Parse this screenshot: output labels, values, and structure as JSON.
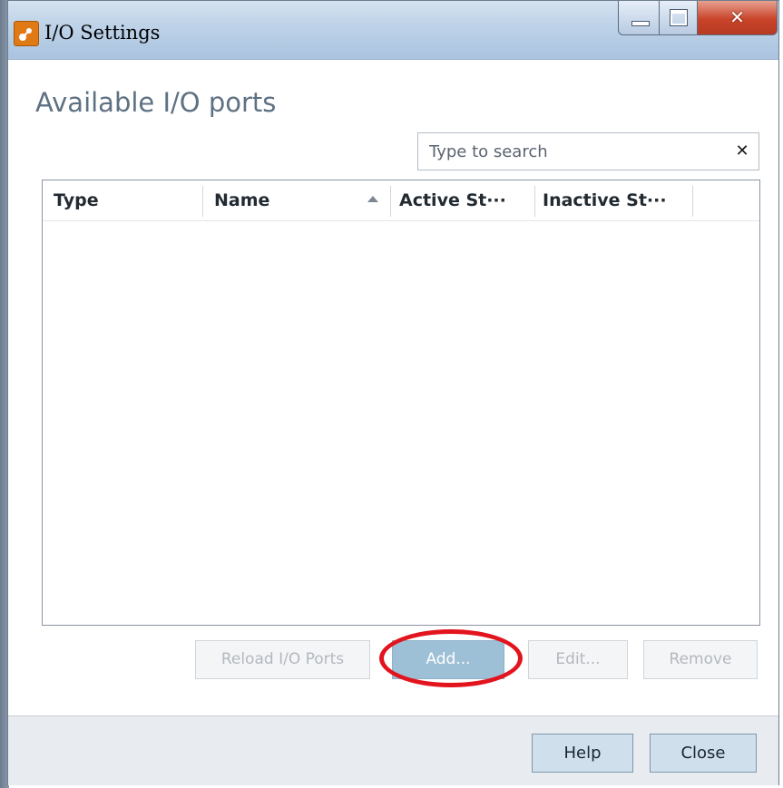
{
  "window": {
    "title": "I/O Settings"
  },
  "heading": "Available I/O ports",
  "search": {
    "placeholder": "Type to search",
    "value": "",
    "clear_glyph": "✕"
  },
  "table": {
    "columns": [
      {
        "label": "Type"
      },
      {
        "label": "Name",
        "sort": "ascending"
      },
      {
        "label": "Active St···"
      },
      {
        "label": "Inactive St···"
      }
    ],
    "rows": []
  },
  "actions": {
    "reload": {
      "label": "Reload I/O Ports",
      "enabled": false
    },
    "add": {
      "label": "Add...",
      "enabled": true
    },
    "edit": {
      "label": "Edit...",
      "enabled": false
    },
    "remove": {
      "label": "Remove",
      "enabled": false
    }
  },
  "footer": {
    "help": "Help",
    "close": "Close"
  },
  "icons": {
    "app": "app-icon",
    "sort": "sort-ascending-icon",
    "clear": "close-icon"
  },
  "colors": {
    "heading": "#5e7183",
    "highlight_ring": "#e2141e",
    "primary_button": "#9ec0d6",
    "titlebar": "#bdd2e8"
  }
}
